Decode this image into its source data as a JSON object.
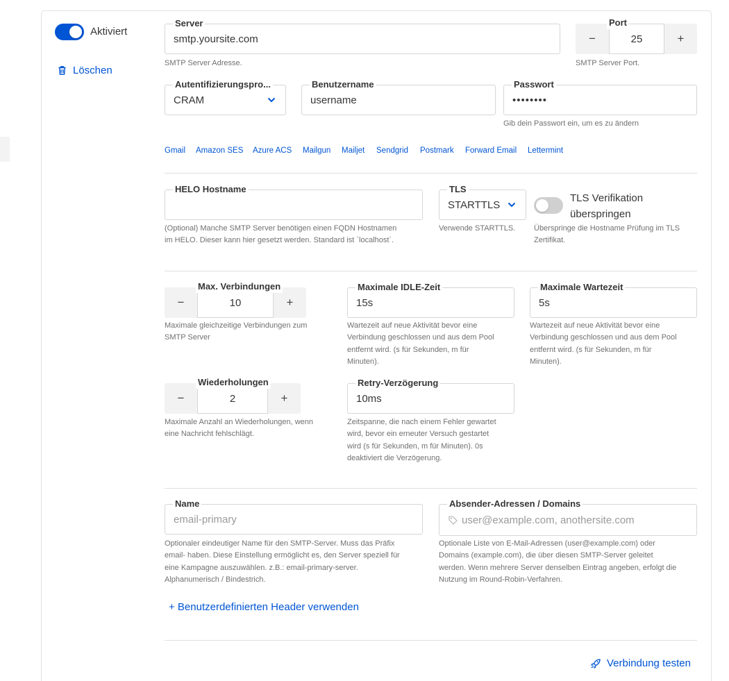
{
  "status": {
    "toggle_label": "Aktiviert",
    "enabled": true
  },
  "delete_label": "Löschen",
  "server": {
    "label": "Server",
    "value": "smtp.yoursite.com",
    "help": "SMTP Server Adresse."
  },
  "port": {
    "label": "Port",
    "value": "25",
    "help": "SMTP Server Port.",
    "minus": "−",
    "plus": "+"
  },
  "auth": {
    "label": "Autentifizierungspro...",
    "value": "CRAM"
  },
  "username": {
    "label": "Benutzername",
    "value": "username"
  },
  "password": {
    "label": "Passwort",
    "value": "••••••••",
    "help": "Gib dein Passwort ein, um es zu ändern"
  },
  "providers": [
    "Gmail",
    "Amazon SES",
    "Azure ACS",
    "Mailgun",
    "Mailjet",
    "Sendgrid",
    "Postmark",
    "Forward Email",
    "Lettermint"
  ],
  "helo": {
    "label": "HELO Hostname",
    "value": "",
    "help_lines": [
      "(Optional) Manche SMTP Server benötigen einen FQDN Hostnamen",
      "im HELO. Dieser kann hier gesetzt werden. Standard ist `localhost`."
    ]
  },
  "tls": {
    "label": "TLS",
    "value": "STARTTLS",
    "help": "Verwende STARTTLS."
  },
  "tls_skip": {
    "label_lines": [
      "TLS Verifikation",
      "überspringen"
    ],
    "enabled": false,
    "help_lines": [
      "Überspringe die Hostname Prüfung im TLS",
      "Zertifikat."
    ]
  },
  "max_conns": {
    "label": "Max. Verbindungen",
    "value": "10",
    "help_lines": [
      "Maximale gleichzeitige Verbindungen zum",
      "SMTP Server"
    ]
  },
  "idle_time": {
    "label": "Maximale IDLE-Zeit",
    "value": "15s",
    "help_lines": [
      "Wartezeit auf neue Aktivität bevor eine",
      "Verbindung geschlossen und aus dem Pool",
      "entfernt wird. (s für Sekunden, m für",
      "Minuten)."
    ]
  },
  "wait_time": {
    "label": "Maximale Wartezeit",
    "value": "5s",
    "help_lines": [
      "Wartezeit auf neue Aktivität bevor eine",
      "Verbindung geschlossen und aus dem Pool",
      "entfernt wird. (s für Sekunden, m für",
      "Minuten)."
    ]
  },
  "retries": {
    "label": "Wiederholungen",
    "value": "2",
    "help_lines": [
      "Maximale Anzahl an Wiederholungen, wenn",
      "eine Nachricht fehlschlägt."
    ]
  },
  "retry_delay": {
    "label": "Retry-Verzögerung",
    "value": "10ms",
    "help_lines": [
      "Zeitspanne, die nach einem Fehler gewartet",
      "wird, bevor ein erneuter Versuch gestartet",
      "wird (s für Sekunden, m für Minuten). 0s",
      "deaktiviert die Verzögerung."
    ]
  },
  "name": {
    "label": "Name",
    "placeholder": "email-primary",
    "help_lines": [
      "Optionaler eindeutiger Name für den SMTP-Server. Muss das Präfix",
      "email- haben. Diese Einstellung ermöglicht es, den Server speziell für",
      "eine Kampagne auszuwählen. z.B.: email-primary-server.",
      "Alphanumerisch / Bindestrich."
    ]
  },
  "senders": {
    "label": "Absender-Adressen / Domains",
    "placeholder": "user@example.com, anothersite.com",
    "help_lines": [
      "Optionale Liste von E-Mail-Adressen (user@example.com) oder",
      "Domains (example.com), die über diesen SMTP-Server geleitet",
      "werden. Wenn mehrere Server denselben Eintrag angeben, erfolgt die",
      "Nutzung im Round-Robin-Verfahren."
    ]
  },
  "custom_headers_label": "+ Benutzerdefinierten Header verwenden",
  "test_connection_label": "Verbindung testen",
  "colors": {
    "accent": "#0055d4",
    "toggle_off": "#d0d0d0",
    "stepper_bg": "#f2f2f2"
  }
}
